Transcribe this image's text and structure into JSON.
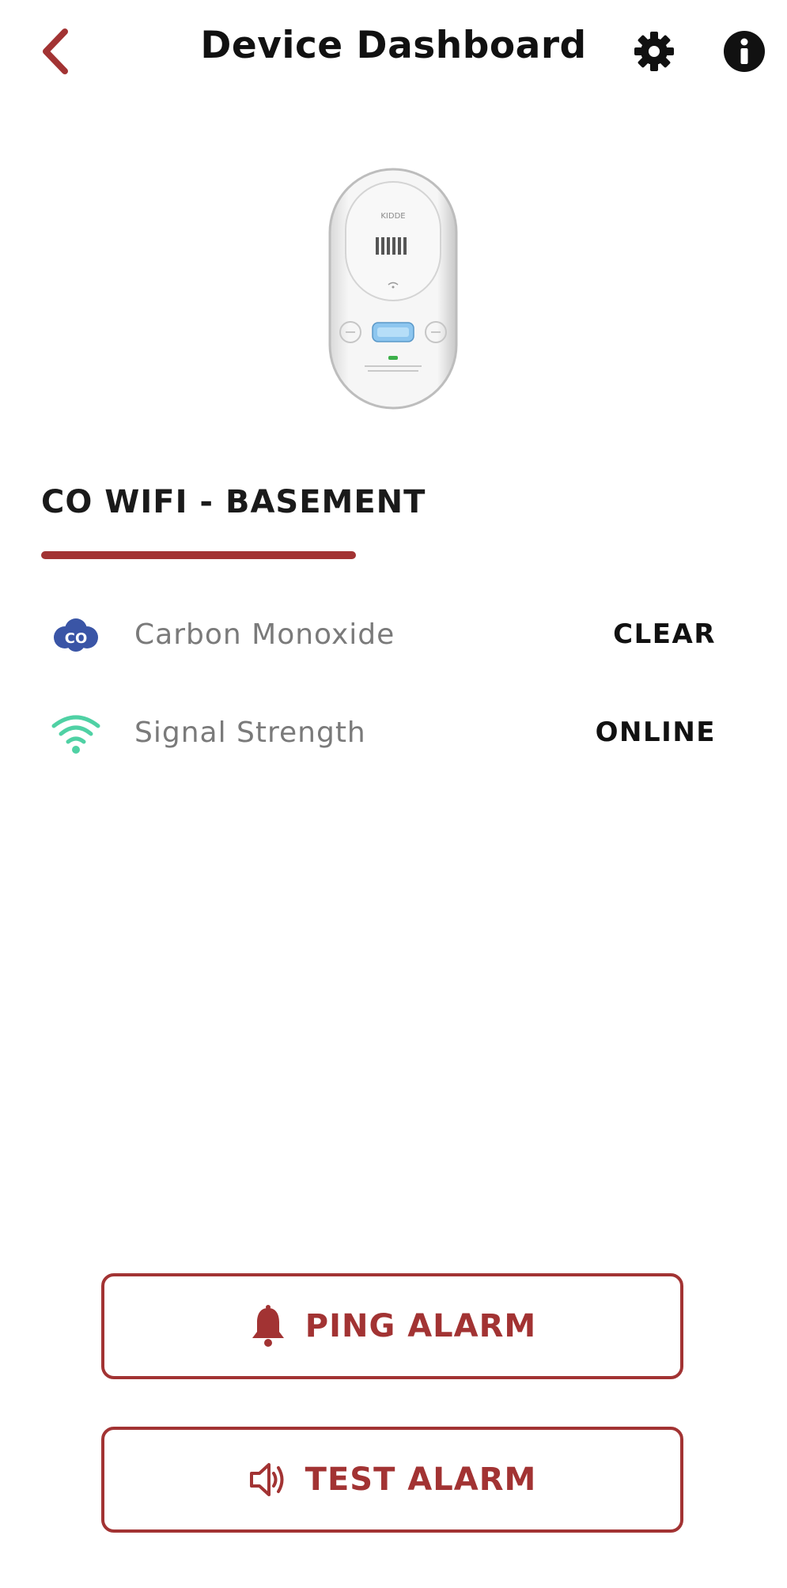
{
  "header": {
    "title": "Device Dashboard",
    "back_icon": "chevron-left-icon",
    "settings_icon": "gear-icon",
    "info_icon": "info-icon"
  },
  "device": {
    "name": "CO WIFI - BASEMENT",
    "brand_label": "KIDDE"
  },
  "status": [
    {
      "icon": "co-icon",
      "label": "Carbon Monoxide",
      "value": "CLEAR"
    },
    {
      "icon": "wifi-icon",
      "label": "Signal Strength",
      "value": "ONLINE"
    }
  ],
  "actions": {
    "ping_label": "PING ALARM",
    "test_label": "TEST ALARM"
  },
  "colors": {
    "accent": "#a23333",
    "co_icon": "#3a55a6",
    "wifi_icon": "#4fd1a4"
  }
}
